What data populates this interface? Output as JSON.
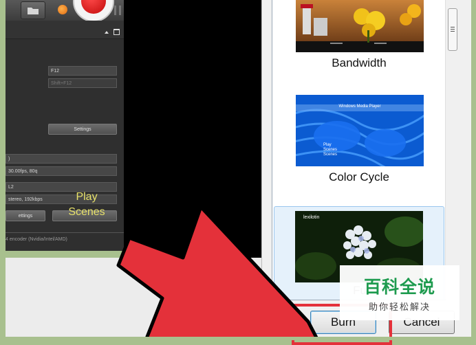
{
  "recorder": {
    "hotkey_value": "F12",
    "hotkey_alt_value": "Shift+F12",
    "settings_label": "Settings",
    "fields": [
      ")",
      "30.00fps, 80q",
      "",
      "L2",
      "stereo, 192kbps"
    ],
    "settings_label_2": "ettings",
    "play_scenes_label": "Play\nScenes",
    "encoder_text": "4 encoder (Nvidia/Intel/AMD)"
  },
  "dialog": {
    "themes": [
      {
        "name": "Bandwidth",
        "icon": "bandwidth-theme-thumbnail"
      },
      {
        "name": "Color Cycle",
        "icon": "color-cycle-theme-thumbnail",
        "thumb_caption": "Windows Media Player",
        "thumb_menu": [
          "Play",
          "Scenes",
          "Scenes"
        ]
      },
      {
        "name": "Fu",
        "icon": "hydrangea-theme-thumbnail",
        "thumb_caption": "lexilotin",
        "selected": true
      }
    ],
    "burn_label": "Burn",
    "cancel_label": "Cancel"
  },
  "watermark": {
    "title": "百科全说",
    "subtitle": "助你轻松解决"
  },
  "colors": {
    "arrow": "#e4313a",
    "highlight": "#e4313a",
    "watermark_green": "#1e9b4f",
    "background_green": "#a8c08e"
  }
}
